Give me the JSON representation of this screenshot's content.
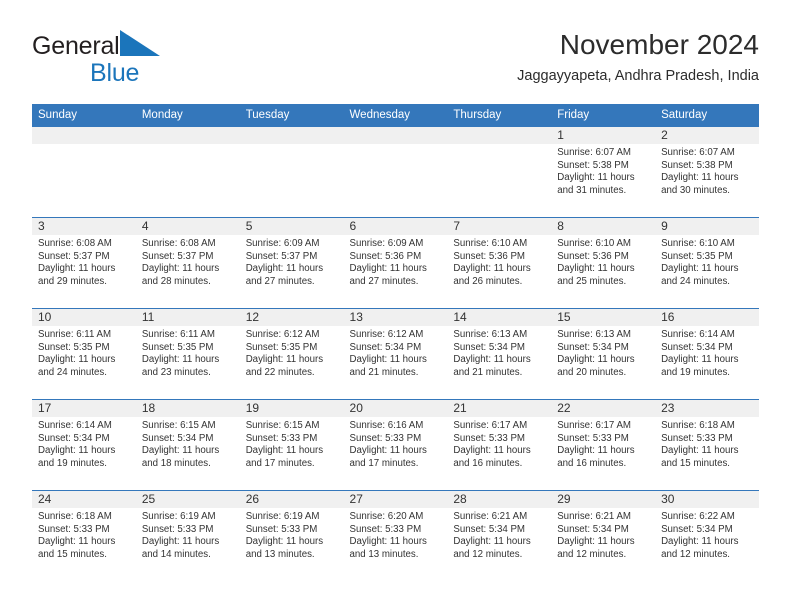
{
  "brand": {
    "name_part1": "General",
    "name_part2": "Blue",
    "triangle_icon": "brand-triangle-icon",
    "colors": {
      "dark": "#231f20",
      "blue": "#1b75bb"
    }
  },
  "header": {
    "title": "November 2024",
    "subtitle": "Jaggayyapeta, Andhra Pradesh, India"
  },
  "colors": {
    "header_bg": "#3477bb",
    "header_text": "#ffffff",
    "daynum_band": "#f0f0f0",
    "cell_bg": "#ffffff",
    "text": "#333333"
  },
  "calendar": {
    "weekday_headers": [
      "Sunday",
      "Monday",
      "Tuesday",
      "Wednesday",
      "Thursday",
      "Friday",
      "Saturday"
    ],
    "labels": {
      "sunrise": "Sunrise:",
      "sunset": "Sunset:",
      "daylight": "Daylight:"
    },
    "weeks": [
      [
        {
          "blank": true
        },
        {
          "blank": true
        },
        {
          "blank": true
        },
        {
          "blank": true
        },
        {
          "blank": true
        },
        {
          "day": "1",
          "sunrise": "Sunrise: 6:07 AM",
          "sunset": "Sunset: 5:38 PM",
          "daylight": "Daylight: 11 hours and 31 minutes."
        },
        {
          "day": "2",
          "sunrise": "Sunrise: 6:07 AM",
          "sunset": "Sunset: 5:38 PM",
          "daylight": "Daylight: 11 hours and 30 minutes."
        }
      ],
      [
        {
          "day": "3",
          "sunrise": "Sunrise: 6:08 AM",
          "sunset": "Sunset: 5:37 PM",
          "daylight": "Daylight: 11 hours and 29 minutes."
        },
        {
          "day": "4",
          "sunrise": "Sunrise: 6:08 AM",
          "sunset": "Sunset: 5:37 PM",
          "daylight": "Daylight: 11 hours and 28 minutes."
        },
        {
          "day": "5",
          "sunrise": "Sunrise: 6:09 AM",
          "sunset": "Sunset: 5:37 PM",
          "daylight": "Daylight: 11 hours and 27 minutes."
        },
        {
          "day": "6",
          "sunrise": "Sunrise: 6:09 AM",
          "sunset": "Sunset: 5:36 PM",
          "daylight": "Daylight: 11 hours and 27 minutes."
        },
        {
          "day": "7",
          "sunrise": "Sunrise: 6:10 AM",
          "sunset": "Sunset: 5:36 PM",
          "daylight": "Daylight: 11 hours and 26 minutes."
        },
        {
          "day": "8",
          "sunrise": "Sunrise: 6:10 AM",
          "sunset": "Sunset: 5:36 PM",
          "daylight": "Daylight: 11 hours and 25 minutes."
        },
        {
          "day": "9",
          "sunrise": "Sunrise: 6:10 AM",
          "sunset": "Sunset: 5:35 PM",
          "daylight": "Daylight: 11 hours and 24 minutes."
        }
      ],
      [
        {
          "day": "10",
          "sunrise": "Sunrise: 6:11 AM",
          "sunset": "Sunset: 5:35 PM",
          "daylight": "Daylight: 11 hours and 24 minutes."
        },
        {
          "day": "11",
          "sunrise": "Sunrise: 6:11 AM",
          "sunset": "Sunset: 5:35 PM",
          "daylight": "Daylight: 11 hours and 23 minutes."
        },
        {
          "day": "12",
          "sunrise": "Sunrise: 6:12 AM",
          "sunset": "Sunset: 5:35 PM",
          "daylight": "Daylight: 11 hours and 22 minutes."
        },
        {
          "day": "13",
          "sunrise": "Sunrise: 6:12 AM",
          "sunset": "Sunset: 5:34 PM",
          "daylight": "Daylight: 11 hours and 21 minutes."
        },
        {
          "day": "14",
          "sunrise": "Sunrise: 6:13 AM",
          "sunset": "Sunset: 5:34 PM",
          "daylight": "Daylight: 11 hours and 21 minutes."
        },
        {
          "day": "15",
          "sunrise": "Sunrise: 6:13 AM",
          "sunset": "Sunset: 5:34 PM",
          "daylight": "Daylight: 11 hours and 20 minutes."
        },
        {
          "day": "16",
          "sunrise": "Sunrise: 6:14 AM",
          "sunset": "Sunset: 5:34 PM",
          "daylight": "Daylight: 11 hours and 19 minutes."
        }
      ],
      [
        {
          "day": "17",
          "sunrise": "Sunrise: 6:14 AM",
          "sunset": "Sunset: 5:34 PM",
          "daylight": "Daylight: 11 hours and 19 minutes."
        },
        {
          "day": "18",
          "sunrise": "Sunrise: 6:15 AM",
          "sunset": "Sunset: 5:34 PM",
          "daylight": "Daylight: 11 hours and 18 minutes."
        },
        {
          "day": "19",
          "sunrise": "Sunrise: 6:15 AM",
          "sunset": "Sunset: 5:33 PM",
          "daylight": "Daylight: 11 hours and 17 minutes."
        },
        {
          "day": "20",
          "sunrise": "Sunrise: 6:16 AM",
          "sunset": "Sunset: 5:33 PM",
          "daylight": "Daylight: 11 hours and 17 minutes."
        },
        {
          "day": "21",
          "sunrise": "Sunrise: 6:17 AM",
          "sunset": "Sunset: 5:33 PM",
          "daylight": "Daylight: 11 hours and 16 minutes."
        },
        {
          "day": "22",
          "sunrise": "Sunrise: 6:17 AM",
          "sunset": "Sunset: 5:33 PM",
          "daylight": "Daylight: 11 hours and 16 minutes."
        },
        {
          "day": "23",
          "sunrise": "Sunrise: 6:18 AM",
          "sunset": "Sunset: 5:33 PM",
          "daylight": "Daylight: 11 hours and 15 minutes."
        }
      ],
      [
        {
          "day": "24",
          "sunrise": "Sunrise: 6:18 AM",
          "sunset": "Sunset: 5:33 PM",
          "daylight": "Daylight: 11 hours and 15 minutes."
        },
        {
          "day": "25",
          "sunrise": "Sunrise: 6:19 AM",
          "sunset": "Sunset: 5:33 PM",
          "daylight": "Daylight: 11 hours and 14 minutes."
        },
        {
          "day": "26",
          "sunrise": "Sunrise: 6:19 AM",
          "sunset": "Sunset: 5:33 PM",
          "daylight": "Daylight: 11 hours and 13 minutes."
        },
        {
          "day": "27",
          "sunrise": "Sunrise: 6:20 AM",
          "sunset": "Sunset: 5:33 PM",
          "daylight": "Daylight: 11 hours and 13 minutes."
        },
        {
          "day": "28",
          "sunrise": "Sunrise: 6:21 AM",
          "sunset": "Sunset: 5:34 PM",
          "daylight": "Daylight: 11 hours and 12 minutes."
        },
        {
          "day": "29",
          "sunrise": "Sunrise: 6:21 AM",
          "sunset": "Sunset: 5:34 PM",
          "daylight": "Daylight: 11 hours and 12 minutes."
        },
        {
          "day": "30",
          "sunrise": "Sunrise: 6:22 AM",
          "sunset": "Sunset: 5:34 PM",
          "daylight": "Daylight: 11 hours and 12 minutes."
        }
      ]
    ]
  }
}
